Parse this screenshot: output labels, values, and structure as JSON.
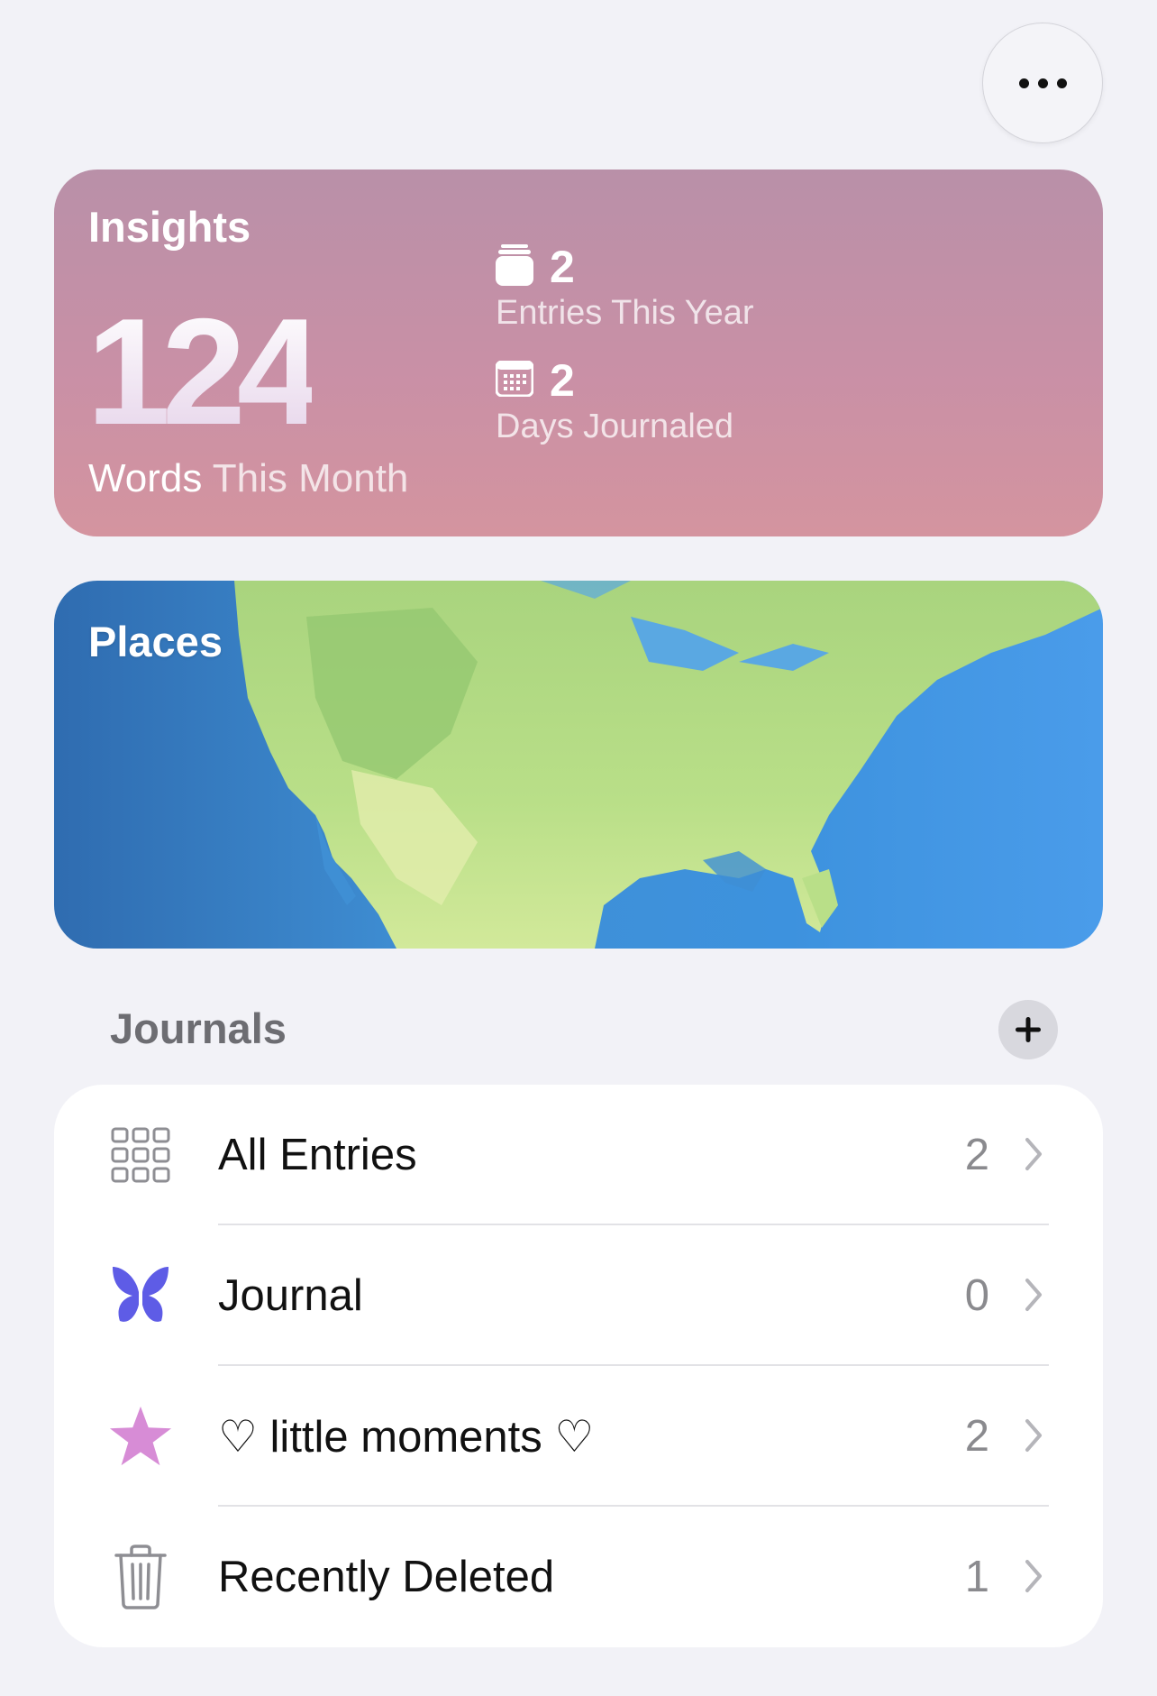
{
  "top_bar": {
    "more_icon": "ellipsis-icon"
  },
  "insights": {
    "title": "Insights",
    "words_count": "124",
    "words_label_1": "Words",
    "words_label_2": "This Month",
    "entries_count": "2",
    "entries_label": "Entries This Year",
    "entries_icon": "stack-icon",
    "days_count": "2",
    "days_label": "Days Journaled",
    "days_icon": "calendar-icon"
  },
  "places": {
    "title": "Places"
  },
  "journals": {
    "header": "Journals",
    "add_icon": "plus-icon",
    "items": [
      {
        "label": "All Entries",
        "count": "2",
        "icon": "grid-icon"
      },
      {
        "label": "Journal",
        "count": "0",
        "icon": "butterfly-icon"
      },
      {
        "label": "♡ little moments ♡",
        "count": "2",
        "icon": "star-icon"
      },
      {
        "label": "Recently Deleted",
        "count": "1",
        "icon": "trash-icon"
      }
    ]
  },
  "colors": {
    "insights_gradient_top": "#b990a8",
    "insights_gradient_bottom": "#d4949f",
    "butterfly": "#5e5ce6",
    "star": "#d78cd6"
  }
}
